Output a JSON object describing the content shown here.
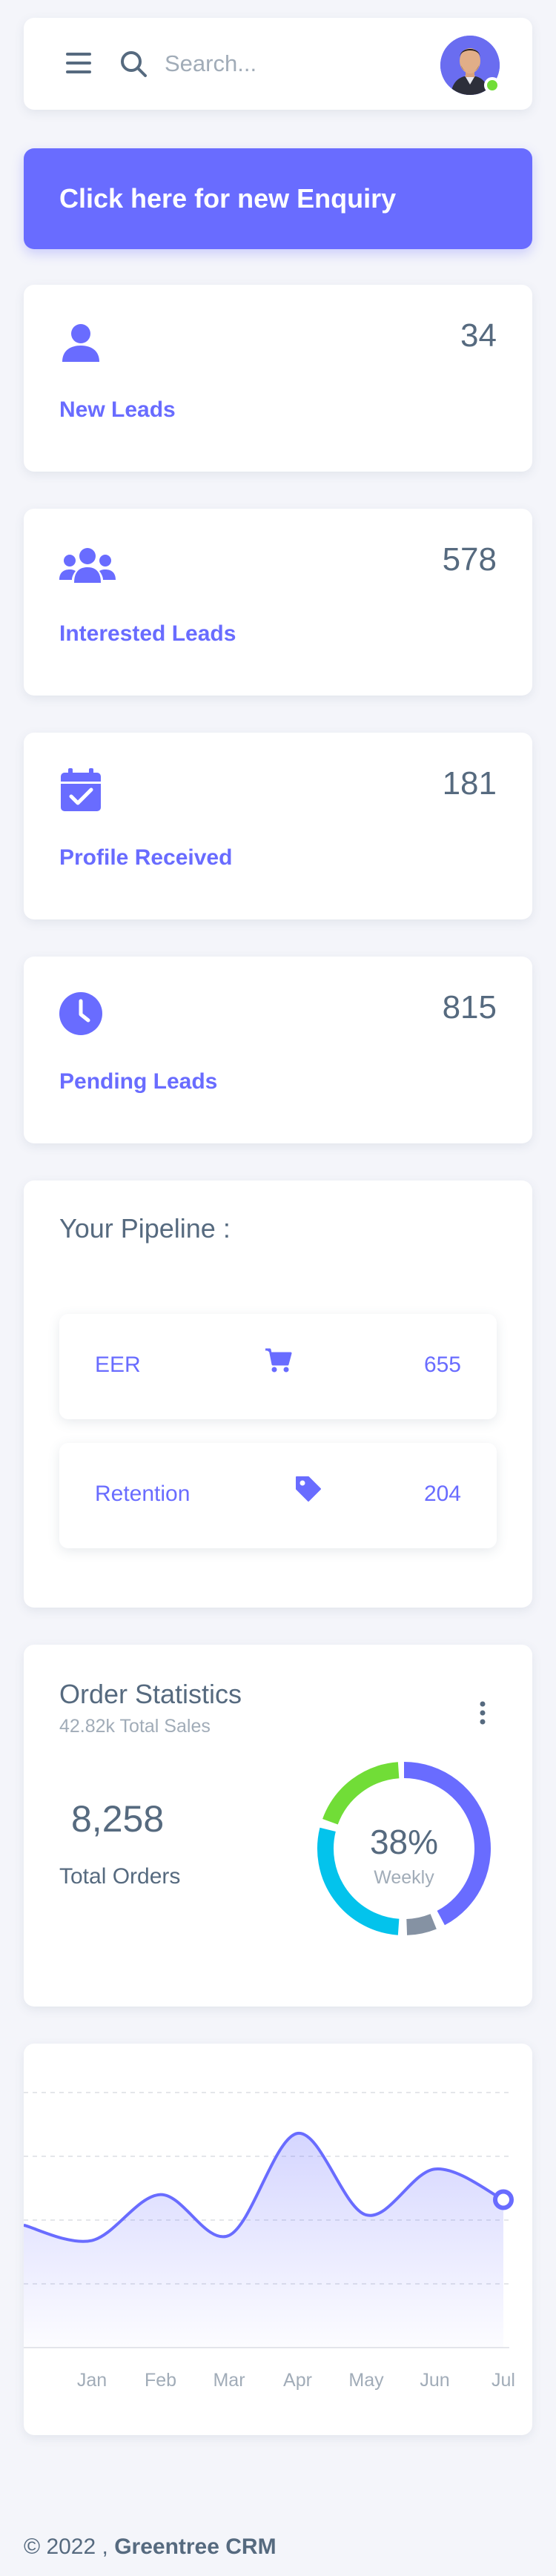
{
  "search": {
    "placeholder": "Search..."
  },
  "enquiry": {
    "label": "Click here for new Enquiry"
  },
  "stats": [
    {
      "value": "34",
      "label": "New Leads",
      "icon": "user-icon"
    },
    {
      "value": "578",
      "label": "Interested Leads",
      "icon": "users-group-icon"
    },
    {
      "value": "181",
      "label": "Profile Received",
      "icon": "calendar-check-icon"
    },
    {
      "value": "815",
      "label": "Pending Leads",
      "icon": "clock-icon"
    }
  ],
  "pipeline": {
    "title": "Your Pipeline :",
    "rows": [
      {
        "name": "EER",
        "value": "655",
        "icon": "cart-icon"
      },
      {
        "name": "Retention",
        "value": "204",
        "icon": "tag-icon"
      }
    ]
  },
  "orders": {
    "title": "Order Statistics",
    "subtitle": "42.82k Total Sales",
    "value": "8,258",
    "label": "Total Orders",
    "donut_percent": "38%",
    "donut_label": "Weekly"
  },
  "colors": {
    "primary": "#696cff",
    "success": "#71dd37",
    "info": "#03c3ec",
    "secondary": "#8592a3",
    "text": "#566a7f",
    "muted": "#a1acb8"
  },
  "chart_data": {
    "type": "area",
    "categories": [
      "Jan",
      "Feb",
      "Mar",
      "Apr",
      "May",
      "Jun",
      "Jul"
    ],
    "series": [
      {
        "values": [
          21,
          30,
          22,
          42,
          26,
          35,
          29
        ]
      }
    ],
    "ylim": [
      0,
      50
    ],
    "grid": true
  },
  "footer": {
    "prefix": "© 2022 , ",
    "brand": "Greentree CRM"
  }
}
